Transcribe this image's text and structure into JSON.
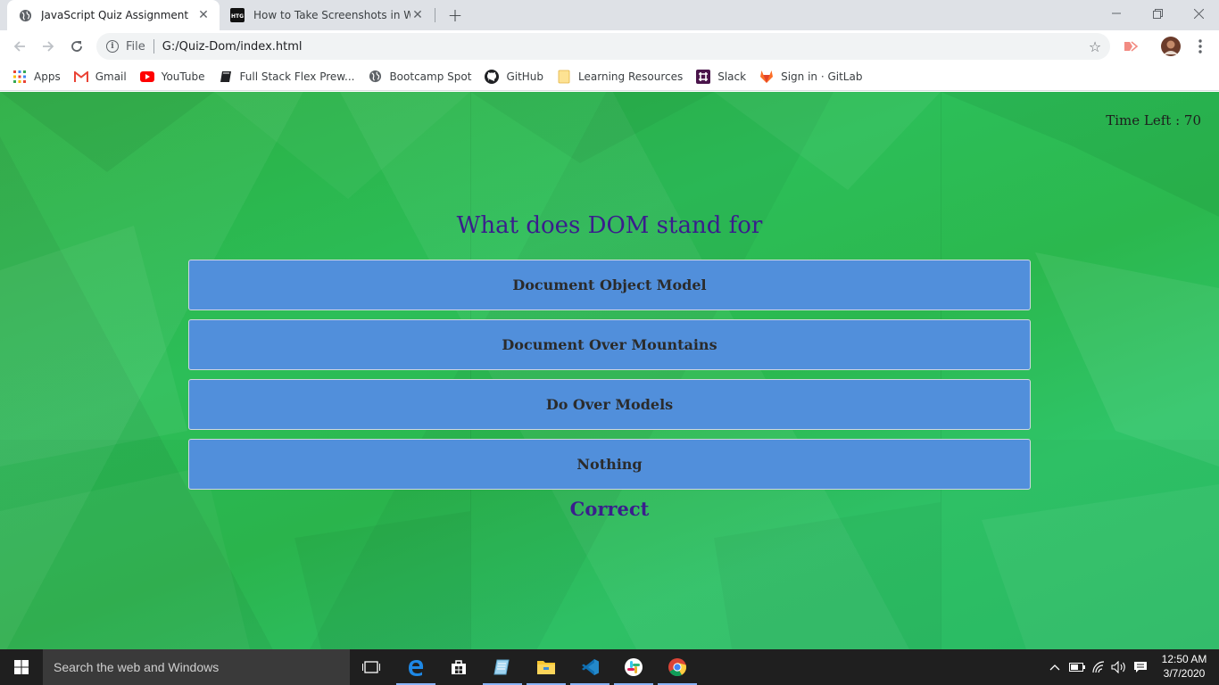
{
  "browser": {
    "tabs": [
      {
        "title": "JavaScript Quiz Assignment",
        "favicon": "globe-icon",
        "active": true
      },
      {
        "title": "How to Take Screenshots in Windows",
        "favicon": "htg-icon",
        "favicon_text": "HTG",
        "active": false
      }
    ],
    "address": {
      "scheme_label": "File",
      "url": "G:/Quiz-Dom/index.html"
    },
    "bookmarks": [
      {
        "label": "Apps",
        "icon": "apps-grid-icon"
      },
      {
        "label": "Gmail",
        "icon": "gmail-icon"
      },
      {
        "label": "YouTube",
        "icon": "youtube-icon"
      },
      {
        "label": "Full Stack Flex Prew...",
        "icon": "book-icon"
      },
      {
        "label": "Bootcamp Spot",
        "icon": "globe-icon"
      },
      {
        "label": "GitHub",
        "icon": "github-icon"
      },
      {
        "label": "Learning Resources",
        "icon": "folder-icon"
      },
      {
        "label": "Slack",
        "icon": "slack-icon"
      },
      {
        "label": "Sign in · GitLab",
        "icon": "gitlab-icon"
      }
    ]
  },
  "quiz": {
    "time_label": "Time Left : 70",
    "question": "What does DOM stand for",
    "answers": [
      "Document Object Model",
      "Document Over Mountains",
      "Do Over Models",
      "Nothing"
    ],
    "feedback": "Correct"
  },
  "taskbar": {
    "search_placeholder": "Search the web and Windows",
    "time": "12:50 AM",
    "date": "3/7/2020"
  },
  "colors": {
    "page_green": "#2bb84e",
    "answer_blue": "#518fdb",
    "text_purple": "#3a1e8c"
  }
}
